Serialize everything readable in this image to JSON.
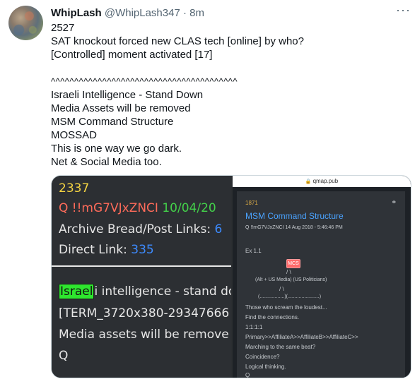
{
  "tweet": {
    "display_name": "WhipLash",
    "handle": "@WhipLash347",
    "separator": "·",
    "time": "8m",
    "more_glyph": "···",
    "lines": [
      "2527",
      "SAT knockout forced new CLAS tech [online] by who?",
      "[Controlled] moment activated [17]",
      "",
      "^^^^^^^^^^^^^^^^^^^^^^^^^^^^^^^^^^^^^^^^",
      "Israeli Intelligence - Stand Down",
      "Media Assets will be removed",
      "MSM Command Structure",
      "MOSSAD",
      "This is one way we go dark.",
      "Net & Social Media too."
    ]
  },
  "left_image": {
    "post_num": "2337",
    "q": "Q",
    "trip": "!!mG7VJxZNCI",
    "date": "10/04/20",
    "archive_label": "Archive Bread/Post Links:",
    "archive_value": "6",
    "direct_label": "Direct Link:",
    "direct_value": "335",
    "highlight_word": "Israel",
    "line1_rest": "i intelligence - stand do",
    "line2": "[TERM_3720x380-29347666",
    "line3": "Media assets will be remove",
    "line4": "Q"
  },
  "right_image": {
    "url": "qmap.pub",
    "post_num": "1871",
    "title": "MSM Command Structure",
    "meta": "Q  !!mG7VJxZNCI  14 Aug 2018 - 5:46:46 PM",
    "ex": "Ex 1.1",
    "mcs": "MCS",
    "slashes": "/       \\",
    "tier2": "(Alt + US Media)  (US Politicians)",
    "slash2": "/           \\",
    "tier3": "(..................)(.......................)",
    "body": [
      "Those who scream the loudest...",
      "Find the connections.",
      "1:1:1:1",
      "Primary>>AffiliateA>>AffiliateB>>AffiliateC>>",
      "Marching to the same beat?",
      "Coincidence?",
      "Logical thinking.",
      "Q"
    ]
  }
}
